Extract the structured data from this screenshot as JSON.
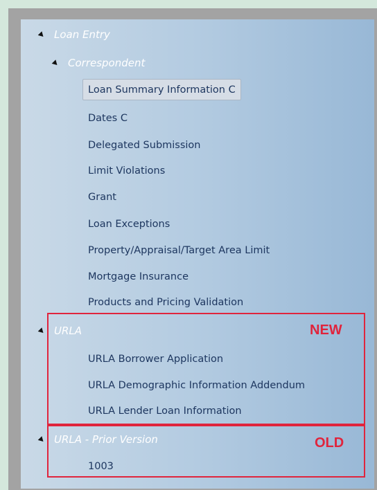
{
  "tree": {
    "root": {
      "label": "Loan Entry"
    },
    "correspondent": {
      "label": "Correspondent",
      "items": [
        "Loan Summary Information C",
        "Dates C",
        "Delegated Submission",
        "Limit Violations",
        "Grant",
        "Loan Exceptions",
        "Property/Appraisal/Target Area Limit",
        "Mortgage Insurance",
        "Products and Pricing Validation"
      ],
      "selected_item": "Loan Summary Information C"
    },
    "urla": {
      "label": "URLA",
      "items": [
        "URLA Borrower Application",
        "URLA Demographic Information Addendum",
        "URLA Lender Loan Information"
      ]
    },
    "urla_prior": {
      "label": "URLA - Prior Version",
      "items": [
        "1003"
      ]
    }
  },
  "annotations": {
    "new_label": "NEW",
    "old_label": "OLD",
    "highlight_color": "#e0243c"
  },
  "icons": {
    "expanded": "expanded-triangle-icon"
  }
}
